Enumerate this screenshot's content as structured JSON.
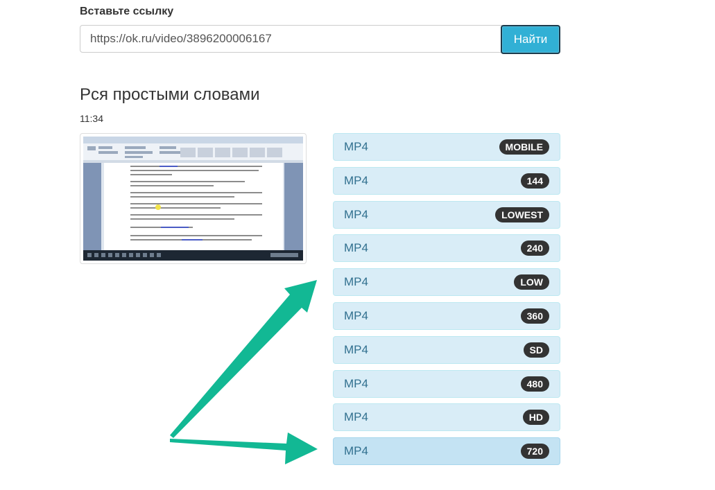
{
  "form": {
    "label": "Вставьте ссылку",
    "url_value": "https://ok.ru/video/3896200006167",
    "find_button": "Найти"
  },
  "video": {
    "title": "Рся простыми словами",
    "duration": "11:34"
  },
  "formats": [
    {
      "type": "MP4",
      "quality": "MOBILE"
    },
    {
      "type": "MP4",
      "quality": "144"
    },
    {
      "type": "MP4",
      "quality": "LOWEST"
    },
    {
      "type": "MP4",
      "quality": "240"
    },
    {
      "type": "MP4",
      "quality": "LOW"
    },
    {
      "type": "MP4",
      "quality": "360"
    },
    {
      "type": "MP4",
      "quality": "SD"
    },
    {
      "type": "MP4",
      "quality": "480"
    },
    {
      "type": "MP4",
      "quality": "HD"
    },
    {
      "type": "MP4",
      "quality": "720"
    }
  ],
  "colors": {
    "accent_button": "#31b0d5",
    "format_bg": "#d9edf7",
    "format_text": "#31708f",
    "badge_bg": "#333333",
    "annotation_arrow": "#12b894"
  }
}
